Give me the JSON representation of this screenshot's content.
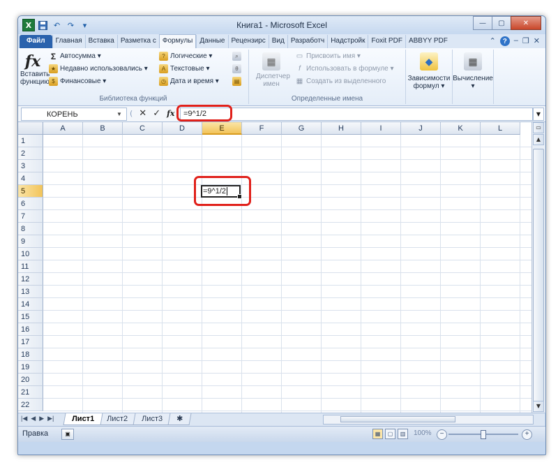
{
  "window": {
    "title": "Книга1 - Microsoft Excel",
    "minimize": "—",
    "maximize": "▢",
    "close": "✕"
  },
  "qat": {
    "undo": "↶",
    "redo": "↷",
    "dropdown": "▾"
  },
  "tabs": [
    {
      "label": "Файл"
    },
    {
      "label": "Главная"
    },
    {
      "label": "Вставка"
    },
    {
      "label": "Разметка с"
    },
    {
      "label": "Формулы"
    },
    {
      "label": "Данные"
    },
    {
      "label": "Рецензирс"
    },
    {
      "label": "Вид"
    },
    {
      "label": "Разработч"
    },
    {
      "label": "Надстройк"
    },
    {
      "label": "Foxit PDF"
    },
    {
      "label": "ABBYY PDF"
    }
  ],
  "ribbon": {
    "insert_function": {
      "icon_text": "fx",
      "line1": "Вставить",
      "line2": "функцию"
    },
    "lib": {
      "autosum": "Автосумма ▾",
      "recent": "Недавно использовались ▾",
      "financial": "Финансовые ▾",
      "logical": "Логические ▾",
      "text": "Текстовые ▾",
      "datetime": "Дата и время ▾",
      "group_label": "Библиотека функций"
    },
    "names": {
      "manager_line1": "Диспетчер",
      "manager_line2": "имен",
      "define": "Присвоить имя ▾",
      "use_in_formula": "Использовать в формуле ▾",
      "create_from_sel": "Создать из выделенного",
      "group_label": "Определенные имена"
    },
    "dependencies": {
      "line1": "Зависимости",
      "line2": "формул ▾"
    },
    "calculation": {
      "line1": "Вычисление",
      "line2": "▾"
    }
  },
  "formula_bar": {
    "name_box": "КОРЕНЬ",
    "cancel": "✕",
    "enter": "✓",
    "fx": "fx",
    "value": "=9^1/2"
  },
  "columns": [
    "A",
    "B",
    "C",
    "D",
    "E",
    "F",
    "G",
    "H",
    "I",
    "J",
    "K",
    "L"
  ],
  "selected_column": "E",
  "rows": [
    "1",
    "2",
    "3",
    "4",
    "5",
    "6",
    "7",
    "8",
    "9",
    "10",
    "11",
    "12",
    "13",
    "14",
    "15",
    "16",
    "17",
    "18",
    "19",
    "20",
    "21",
    "22"
  ],
  "selected_row": "5",
  "active_cell": {
    "ref": "E5",
    "value": "=9^1/2"
  },
  "sheets": [
    {
      "label": "Лист1"
    },
    {
      "label": "Лист2"
    },
    {
      "label": "Лист3"
    }
  ],
  "status": {
    "mode": "Правка",
    "zoom": "100%",
    "zoom_minus": "−",
    "zoom_plus": "+"
  }
}
